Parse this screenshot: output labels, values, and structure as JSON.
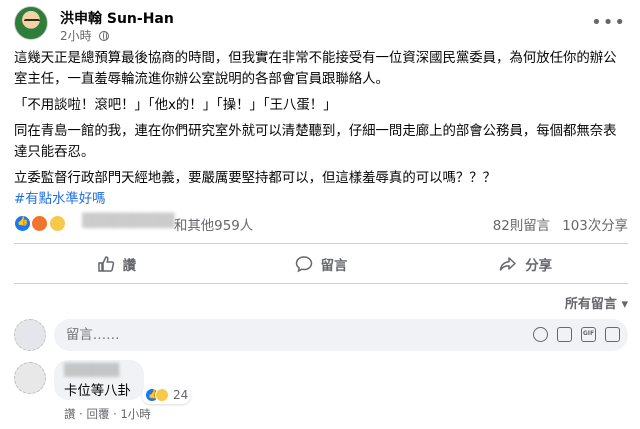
{
  "post": {
    "author": "洪申翰 Sun-Han",
    "time": "2小時",
    "paragraphs": [
      "這幾天正是總預算最後協商的時間，但我實在非常不能接受有一位資深國民黨委員，為何放任你的辦公室主任，一直羞辱輪流進你辦公室說明的各部會官員跟聯絡人。",
      "「不用談啦！滾吧！」「他x的！」「操！」「王八蛋！」",
      "同在青島一館的我，連在你們研究室外就可以清楚聽到，仔細一問走廊上的部會公務員，每個都無奈表達只能吞忍。",
      "立委監督行政部門天經地義，要嚴厲要堅持都可以，但這樣羞辱真的可以嗎？？？"
    ],
    "hashtag": "#有點水準好嗎"
  },
  "reactions": {
    "icons": [
      "like-icon",
      "angry-icon",
      "haha-icon"
    ],
    "others_text": "和其他959人",
    "comments_count": "82則留言",
    "shares_count": "103次分享"
  },
  "actions": {
    "like": "讚",
    "comment": "留言",
    "share": "分享"
  },
  "sort": {
    "label": "所有留言",
    "arrow": "▾"
  },
  "comment_box": {
    "placeholder": "留言……"
  },
  "comments": [
    {
      "text": "卡位等八卦",
      "reaction_count": "24",
      "like": "讚",
      "reply": "回覆",
      "time": "1小時"
    }
  ],
  "colors": {
    "link": "#216fdb",
    "secondary_text": "#65676b",
    "like_blue": "#1877f2",
    "comment_bg": "#f0f2f5"
  }
}
